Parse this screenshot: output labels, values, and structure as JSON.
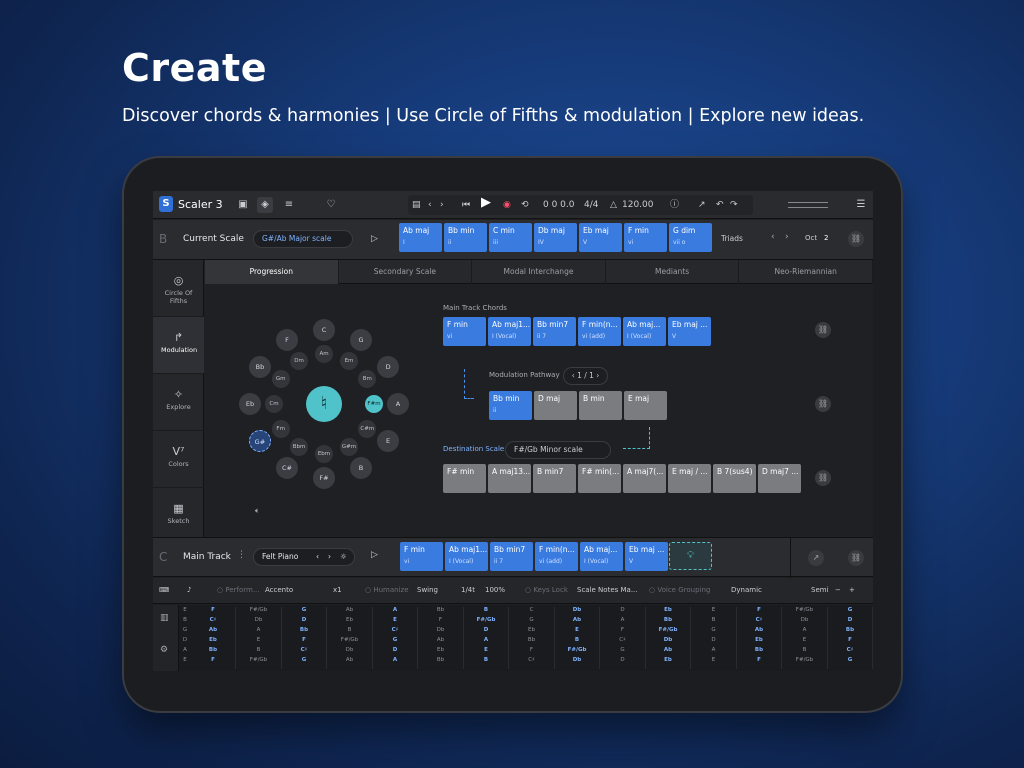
{
  "hero": {
    "title": "Create",
    "subtitle": "Discover chords & harmonies | Use Circle of Fifths & modulation | Explore new ideas."
  },
  "app": {
    "name": "Scaler 3",
    "transport": {
      "time": "0 0 0.0",
      "meter": "4/4",
      "tempo": "120.00"
    }
  },
  "current_scale": {
    "letter": "B",
    "label": "Current Scale",
    "scale": "G#/Ab Major scale",
    "chords": [
      {
        "name": "Ab maj",
        "degree": "I"
      },
      {
        "name": "Bb min",
        "degree": "ii"
      },
      {
        "name": "C min",
        "degree": "iii"
      },
      {
        "name": "Db maj",
        "degree": "IV"
      },
      {
        "name": "Eb maj",
        "degree": "V"
      },
      {
        "name": "F min",
        "degree": "vi"
      },
      {
        "name": "G dim",
        "degree": "vii o"
      }
    ],
    "mode": "Triads",
    "oct_label": "Oct",
    "oct_value": "2"
  },
  "nav": [
    {
      "label": "Circle Of Fifths",
      "icon": "target-icon"
    },
    {
      "label": "Modulation",
      "icon": "modulation-arrow-icon"
    },
    {
      "label": "Explore",
      "icon": "bulb-icon"
    },
    {
      "label": "Colors",
      "icon": "v7-icon"
    },
    {
      "label": "Sketch",
      "icon": "grid-icon"
    }
  ],
  "tabs": [
    "Progression",
    "Secondary Scale",
    "Modal Interchange",
    "Mediants",
    "Neo-Riemannian"
  ],
  "circle": {
    "center": "♮",
    "outer": [
      "C",
      "G",
      "D",
      "A",
      "E",
      "B",
      "F#",
      "C#",
      "G#",
      "Eb",
      "Bb",
      "F"
    ],
    "inner": [
      "Am",
      "Em",
      "Bm",
      "F#m",
      "C#m",
      "G#m",
      "Ebm",
      "Bbm",
      "Fm",
      "Cm",
      "Gm",
      "Dm"
    ]
  },
  "modulation": {
    "main_label": "Main Track Chords",
    "main_chords": [
      {
        "name": "F min",
        "degree": "vi"
      },
      {
        "name": "Ab maj1...",
        "degree": "I (Vocal)"
      },
      {
        "name": "Bb min7",
        "degree": "ii 7"
      },
      {
        "name": "F min(n...",
        "degree": "vi (add)"
      },
      {
        "name": "Ab maj...",
        "degree": "I (Vocal)"
      },
      {
        "name": "Eb maj ...",
        "degree": "V"
      }
    ],
    "pathway_label": "Modulation Pathway",
    "pathway_page": "1 / 1",
    "pathway_chords": [
      {
        "name": "Bb min",
        "degree": "ii",
        "blue": true
      },
      {
        "name": "D maj",
        "degree": "",
        "blue": false
      },
      {
        "name": "B min",
        "degree": "",
        "blue": false
      },
      {
        "name": "E maj",
        "degree": "",
        "blue": false
      }
    ],
    "dest_label": "Destination Scale",
    "dest_scale": "F#/Gb Minor scale",
    "dest_chords": [
      "F# min",
      "A maj13...",
      "B min7",
      "F# min(...",
      "A maj7(...",
      "E maj / ...",
      "B 7(sus4)",
      "D maj7 ..."
    ]
  },
  "main_track": {
    "letter": "C",
    "label": "Main Track",
    "instrument": "Felt Piano",
    "chords": [
      {
        "name": "F min",
        "degree": "vi"
      },
      {
        "name": "Ab maj1...",
        "degree": "I (Vocal)"
      },
      {
        "name": "Bb min7",
        "degree": "ii 7"
      },
      {
        "name": "F min(n...",
        "degree": "vi (add)"
      },
      {
        "name": "Ab maj...",
        "degree": "I (Vocal)"
      },
      {
        "name": "Eb maj ...",
        "degree": "V"
      }
    ]
  },
  "bottombar": {
    "perform": "Perform...",
    "perform_value": "Accento",
    "perform_mult": "x1",
    "humanize": "Humanize",
    "swing": "Swing",
    "division": "1/4t",
    "amount": "100%",
    "keys_lock": "Keys Lock",
    "keys_mode": "Scale Notes Ma...",
    "voice": "Voice Grouping",
    "voice_value": "Dynamic",
    "semi": "Semi",
    "minus": "−",
    "plus": "+"
  },
  "grid": {
    "rows": [
      "E",
      "B",
      "G",
      "D",
      "A",
      "E"
    ],
    "cols": [
      [
        "F",
        "C♯",
        "Ab",
        "Eb",
        "Bb",
        "F"
      ],
      [
        "F#/Gb",
        "Db",
        "A",
        "E",
        "B",
        "F#/Gb"
      ],
      [
        "G",
        "D",
        "Bb",
        "F",
        "C♯",
        "G"
      ],
      [
        "Ab",
        "Eb",
        "B",
        "F#/Gb",
        "Db",
        "Ab"
      ],
      [
        "A",
        "E",
        "C♯",
        "G",
        "D",
        "A"
      ],
      [
        "Bb",
        "F",
        "Db",
        "Ab",
        "Eb",
        "Bb"
      ],
      [
        "B",
        "F#/Gb",
        "D",
        "A",
        "E",
        "B"
      ],
      [
        "C",
        "G",
        "Eb",
        "Bb",
        "F",
        "C♯"
      ],
      [
        "Db",
        "Ab",
        "E",
        "B",
        "F#/Gb",
        "Db"
      ],
      [
        "D",
        "A",
        "F",
        "C♯",
        "G",
        "D"
      ],
      [
        "Eb",
        "Bb",
        "F#/Gb",
        "Db",
        "Ab",
        "Eb"
      ],
      [
        "E",
        "B",
        "G",
        "D",
        "A",
        "E"
      ],
      [
        "F",
        "C♯",
        "Ab",
        "Eb",
        "Bb",
        "F"
      ],
      [
        "F#/Gb",
        "Db",
        "A",
        "E",
        "B",
        "F#/Gb"
      ],
      [
        "G",
        "D",
        "Bb",
        "F",
        "C♯",
        "G"
      ]
    ]
  },
  "colors": {
    "accent": "#3a7be0",
    "teal": "#4fc3c9",
    "gray_chip": "#7a7c80"
  }
}
